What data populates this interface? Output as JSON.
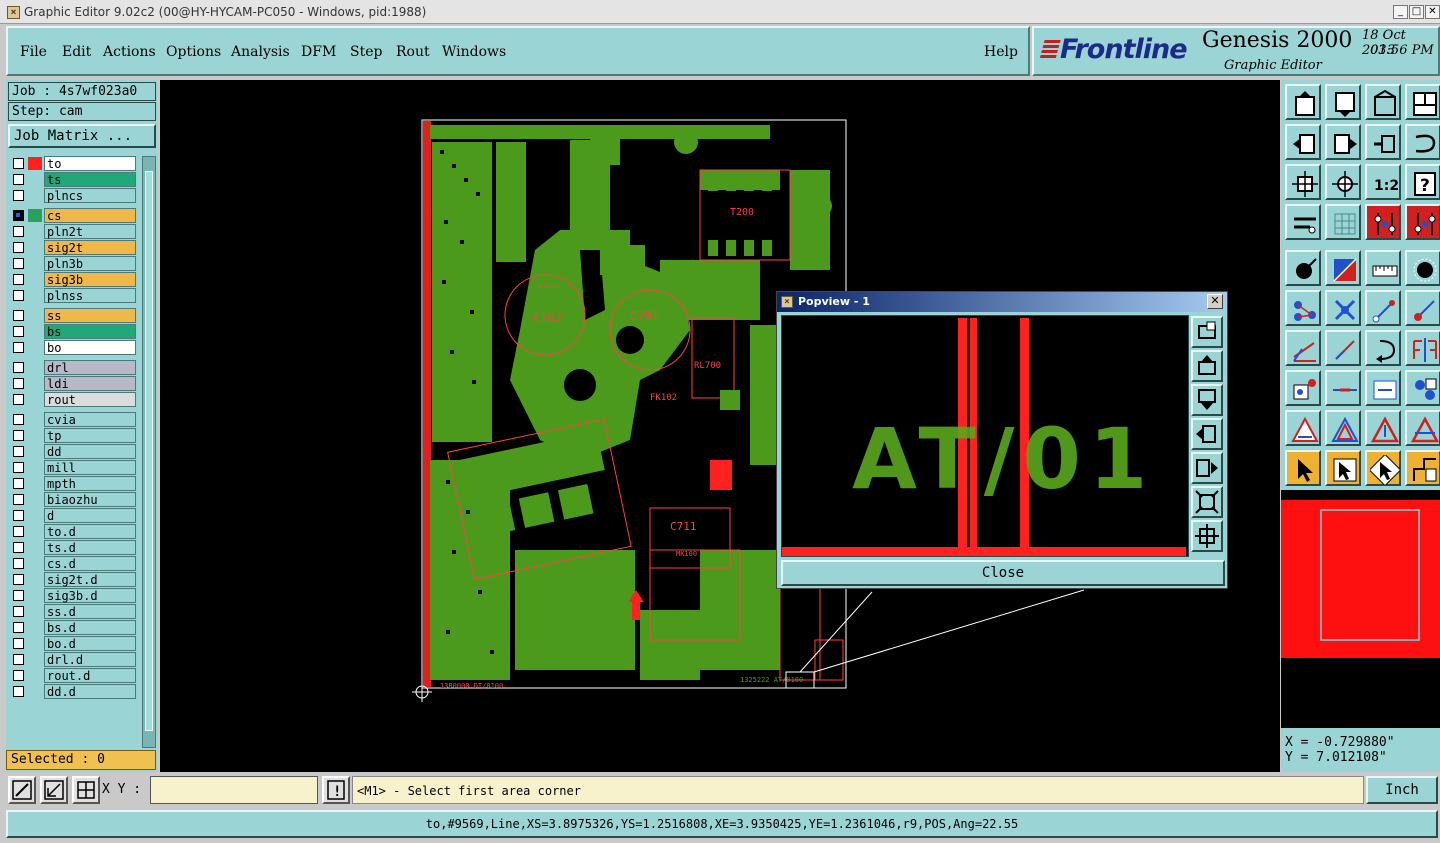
{
  "window": {
    "title": "Graphic Editor 9.02c2 (00@HY-HYCAM-PC050 - Windows, pid:1988)"
  },
  "menu": {
    "items": [
      "File",
      "Edit",
      "Actions",
      "Options",
      "Analysis",
      "DFM",
      "Step",
      "Rout",
      "Windows"
    ],
    "help": "Help"
  },
  "brand": {
    "logo": "Frontline",
    "product": "Genesis 2000",
    "subtitle": "Graphic Editor",
    "date": "18 Oct 2013",
    "time": "03:56 PM"
  },
  "job": {
    "job_label": "Job : 4s7wf023a0",
    "step_label": "Step: cam",
    "matrix_button": "Job Matrix ..."
  },
  "layers": [
    {
      "name": "to",
      "bg": "#ffffff",
      "swatch": "#ff2020",
      "checked": false
    },
    {
      "name": "ts",
      "bg": "#22a878",
      "swatch": "",
      "checked": false
    },
    {
      "name": "plncs",
      "bg": "#9bd4d4",
      "swatch": "",
      "checked": false
    },
    {
      "name": "cs",
      "bg": "#f0b848",
      "swatch": "#2aa060",
      "checked": true
    },
    {
      "name": "pln2t",
      "bg": "#9bd4d4",
      "swatch": "",
      "checked": false
    },
    {
      "name": "sig2t",
      "bg": "#f0b848",
      "swatch": "",
      "checked": false
    },
    {
      "name": "pln3b",
      "bg": "#9bd4d4",
      "swatch": "",
      "checked": false
    },
    {
      "name": "sig3b",
      "bg": "#f0b848",
      "swatch": "",
      "checked": false
    },
    {
      "name": "plnss",
      "bg": "#9bd4d4",
      "swatch": "",
      "checked": false
    },
    {
      "name": "ss",
      "bg": "#f0b848",
      "swatch": "",
      "checked": false
    },
    {
      "name": "bs",
      "bg": "#22a878",
      "swatch": "",
      "checked": false
    },
    {
      "name": "bo",
      "bg": "#ffffff",
      "swatch": "",
      "checked": false
    },
    {
      "name": "drl",
      "bg": "#b8b8c8",
      "swatch": "",
      "checked": false
    },
    {
      "name": "ldi",
      "bg": "#b8b8c8",
      "swatch": "",
      "checked": false
    },
    {
      "name": "rout",
      "bg": "#dcdcdc",
      "swatch": "",
      "checked": false
    },
    {
      "name": "cvia",
      "bg": "#9bd4d4",
      "swatch": "",
      "checked": false
    },
    {
      "name": "tp",
      "bg": "#9bd4d4",
      "swatch": "",
      "checked": false
    },
    {
      "name": "dd",
      "bg": "#9bd4d4",
      "swatch": "",
      "checked": false
    },
    {
      "name": "mill",
      "bg": "#9bd4d4",
      "swatch": "",
      "checked": false
    },
    {
      "name": "mpth",
      "bg": "#9bd4d4",
      "swatch": "",
      "checked": false
    },
    {
      "name": "biaozhu",
      "bg": "#9bd4d4",
      "swatch": "",
      "checked": false
    },
    {
      "name": "d",
      "bg": "#9bd4d4",
      "swatch": "",
      "checked": false
    },
    {
      "name": "to.d",
      "bg": "#9bd4d4",
      "swatch": "",
      "checked": false
    },
    {
      "name": "ts.d",
      "bg": "#9bd4d4",
      "swatch": "",
      "checked": false
    },
    {
      "name": "cs.d",
      "bg": "#9bd4d4",
      "swatch": "",
      "checked": false
    },
    {
      "name": "sig2t.d",
      "bg": "#9bd4d4",
      "swatch": "",
      "checked": false
    },
    {
      "name": "sig3b.d",
      "bg": "#9bd4d4",
      "swatch": "",
      "checked": false
    },
    {
      "name": "ss.d",
      "bg": "#9bd4d4",
      "swatch": "",
      "checked": false
    },
    {
      "name": "bs.d",
      "bg": "#9bd4d4",
      "swatch": "",
      "checked": false
    },
    {
      "name": "bo.d",
      "bg": "#9bd4d4",
      "swatch": "",
      "checked": false
    },
    {
      "name": "drl.d",
      "bg": "#9bd4d4",
      "swatch": "",
      "checked": false
    },
    {
      "name": "rout.d",
      "bg": "#9bd4d4",
      "swatch": "",
      "checked": false
    },
    {
      "name": "dd.d",
      "bg": "#9bd4d4",
      "swatch": "",
      "checked": false
    }
  ],
  "selected_label": "Selected : 0",
  "pcb_labels": {
    "c702": "C702",
    "c701": "C701",
    "rl700": "RL700",
    "t200": "T200",
    "fk102": "FK102",
    "c711": "C711",
    "mk100": "MK100",
    "et701": "ET701",
    "footer": "13B0000 DT/0100",
    "footer2": "1325222 AT/0100"
  },
  "popview": {
    "title": "Popview - 1",
    "text": "AT/01",
    "close_label": "Close"
  },
  "toolbar_icons": [
    "home-icon",
    "open-icon",
    "layer-icon",
    "window-icon",
    "left-icon",
    "right-icon",
    "undo-icon",
    "redo-icon",
    "zoom-fit-icon",
    "pan-icon",
    "scale-icon",
    "help-icon",
    "tools-icon",
    "grid-icon",
    "snap-icon",
    "measure-icon",
    "point-icon",
    "select-icon",
    "ruler-icon",
    "dot-icon",
    "node-icon",
    "cross-icon",
    "vector-icon",
    "arrow-icon",
    "line-icon",
    "slash-icon",
    "rotate-icon",
    "mirror-icon",
    "box-icon",
    "cut-icon",
    "resize-icon",
    "group-icon",
    "triangle-icon",
    "shape-icon",
    "shape-up-icon",
    "shape-flat-icon",
    "cursor-icon",
    "cursor-box-icon",
    "cursor-rot-icon",
    "route-icon"
  ],
  "coords": {
    "x": "X = -0.729880\"",
    "y": "Y = 7.012108\""
  },
  "cmd": {
    "xy_label": "X Y :",
    "xy_value": "",
    "prompt": "<M1> - Select first area corner",
    "unit": "Inch"
  },
  "status": "to,#9569,Line,XS=3.8975326,YS=1.2516808,XE=3.9350425,YE=1.2361046,r9,POS,Ang=22.55",
  "colors": {
    "panel": "#9bd4d4",
    "copper": "#4c9a1c",
    "outline": "#ff2020"
  }
}
